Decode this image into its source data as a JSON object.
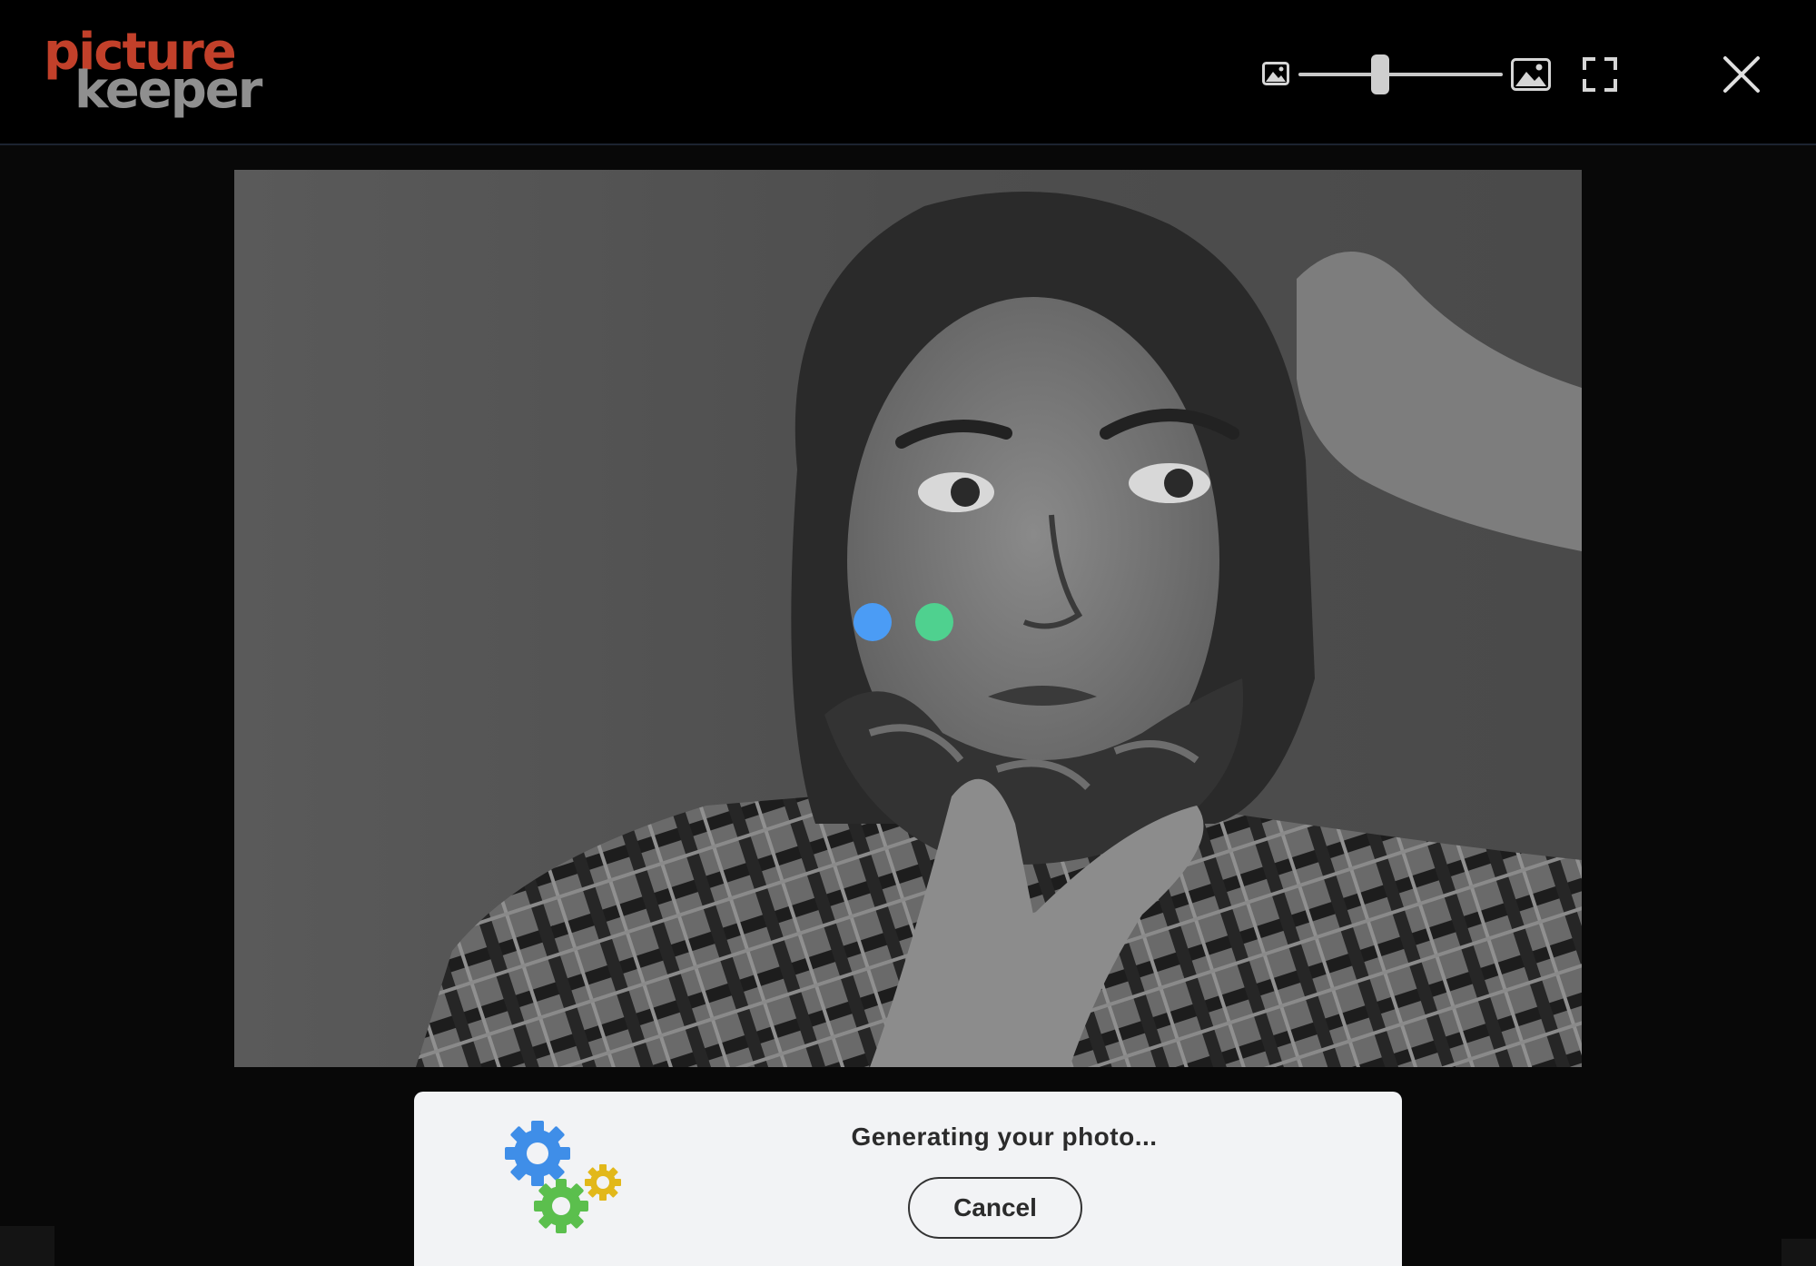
{
  "app": {
    "logo_line1": "picture",
    "logo_line2": "keeper"
  },
  "toolbar": {
    "zoom_small_icon": "image-small-icon",
    "zoom_large_icon": "image-large-icon",
    "zoom_level": 0.4,
    "fullscreen_icon": "fullscreen-icon",
    "close_icon": "close-icon"
  },
  "viewer": {
    "loading_dots": [
      {
        "name": "blue",
        "color": "#4b9cf5"
      },
      {
        "name": "green",
        "color": "#4fd18f"
      }
    ]
  },
  "status_panel": {
    "message": "Generating your photo...",
    "cancel_label": "Cancel",
    "icon": "gears-icon"
  },
  "colors": {
    "logo_primary": "#c2402a",
    "logo_secondary": "#8f8f8f",
    "gear_blue": "#3f8ee8",
    "gear_green": "#5bbf4d",
    "gear_yellow": "#e2b81a"
  }
}
